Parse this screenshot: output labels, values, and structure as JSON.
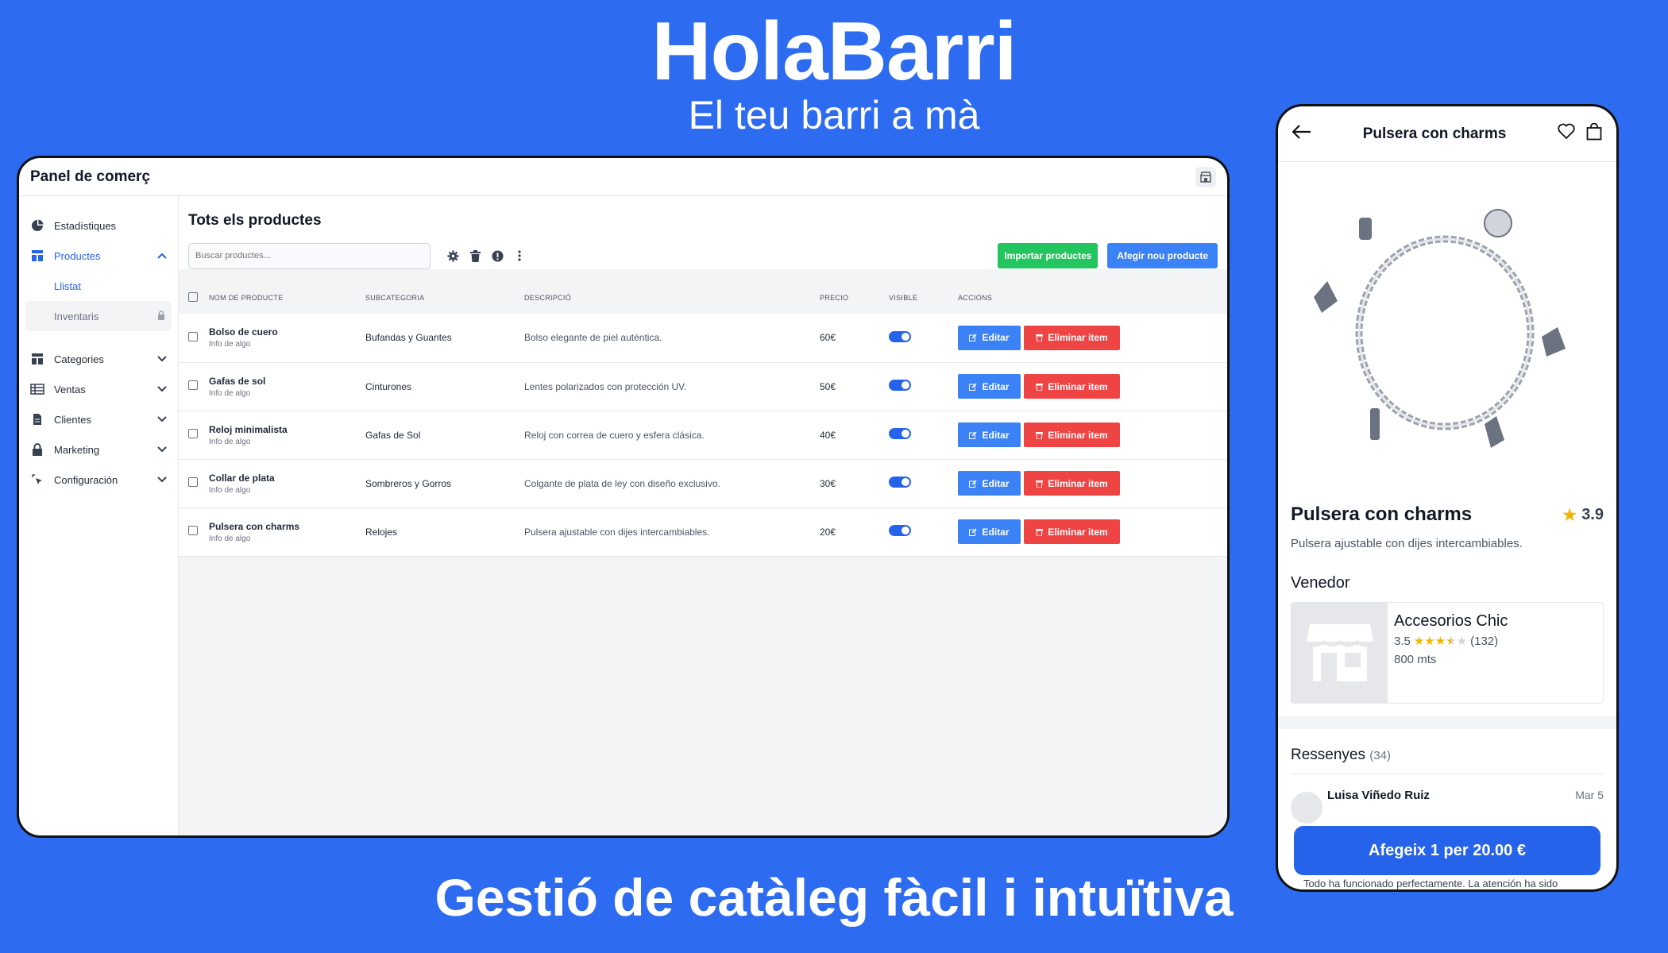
{
  "brand": {
    "name": "HolaBarri",
    "tagline": "El teu barri a mà"
  },
  "footer": {
    "tagline": "Gestió de catàleg fàcil i intuïtiva"
  },
  "panel": {
    "title": "Panel de comerç",
    "sidebar": {
      "items": [
        {
          "label": "Estadístiques",
          "icon": "pie-chart-icon"
        },
        {
          "label": "Productes",
          "icon": "layout-icon",
          "expanded": true
        },
        {
          "label": "Categories",
          "icon": "layout-icon"
        },
        {
          "label": "Ventas",
          "icon": "table-icon"
        },
        {
          "label": "Clientes",
          "icon": "document-icon"
        },
        {
          "label": "Marketing",
          "icon": "lock-icon"
        },
        {
          "label": "Configuración",
          "icon": "cursor-icon"
        }
      ],
      "subitems": [
        {
          "label": "Llistat"
        },
        {
          "label": "Inventaris",
          "locked": true
        }
      ]
    },
    "main": {
      "title": "Tots els productes",
      "search_placeholder": "Buscar productes...",
      "import_label": "Importar productes",
      "add_label": "Afegir nou producte",
      "columns": [
        "NOM DE PRODUCTE",
        "SUBCATEGORIA",
        "DESCRIPCIÓ",
        "PRECIO",
        "VISIBLE",
        "ACCIONS"
      ],
      "edit_label": "Editar",
      "delete_label": "Eliminar item",
      "rows": [
        {
          "name": "Bolso de cuero",
          "info": "Info de algo",
          "subcategory": "Bufandas y Guantes",
          "description": "Bolso elegante de piel auténtica.",
          "price": "60€",
          "visible": true
        },
        {
          "name": "Gafas de sol",
          "info": "Info de algo",
          "subcategory": "Cinturones",
          "description": "Lentes polarizados con protección UV.",
          "price": "50€",
          "visible": true
        },
        {
          "name": "Reloj minimalista",
          "info": "Info de algo",
          "subcategory": "Gafas de Sol",
          "description": "Reloj con correa de cuero y esfera clásica.",
          "price": "40€",
          "visible": true
        },
        {
          "name": "Collar de plata",
          "info": "Info de algo",
          "subcategory": "Sombreros y Gorros",
          "description": "Colgante de plata de ley con diseño exclusivo.",
          "price": "30€",
          "visible": true
        },
        {
          "name": "Pulsera con charms",
          "info": "Info de algo",
          "subcategory": "Relojes",
          "description": "Pulsera ajustable con dijes intercambiables.",
          "price": "20€",
          "visible": true
        }
      ]
    }
  },
  "phone": {
    "header_title": "Pulsera con charms",
    "product": {
      "name": "Pulsera con charms",
      "rating": "3.9",
      "description": "Pulsera ajustable con dijes intercambiables."
    },
    "vendor_heading": "Venedor",
    "vendor": {
      "name": "Accesorios Chic",
      "rating": "3.5",
      "stars": 3.5,
      "reviews": "(132)",
      "distance": "800 mts"
    },
    "reviews_heading": "Ressenyes",
    "reviews_count": "(34)",
    "review": {
      "author": "Luisa Viñedo Ruiz",
      "date": "Mar 5",
      "text": "Todo ha funcionado perfectamente. La atención ha sido"
    },
    "cta": "Afegeix 1 per 20.00 €"
  },
  "colors": {
    "background": "#2d6cf0",
    "primary": "#3b82f6",
    "success": "#22c55e",
    "danger": "#ef4444",
    "star": "#f5b400"
  }
}
